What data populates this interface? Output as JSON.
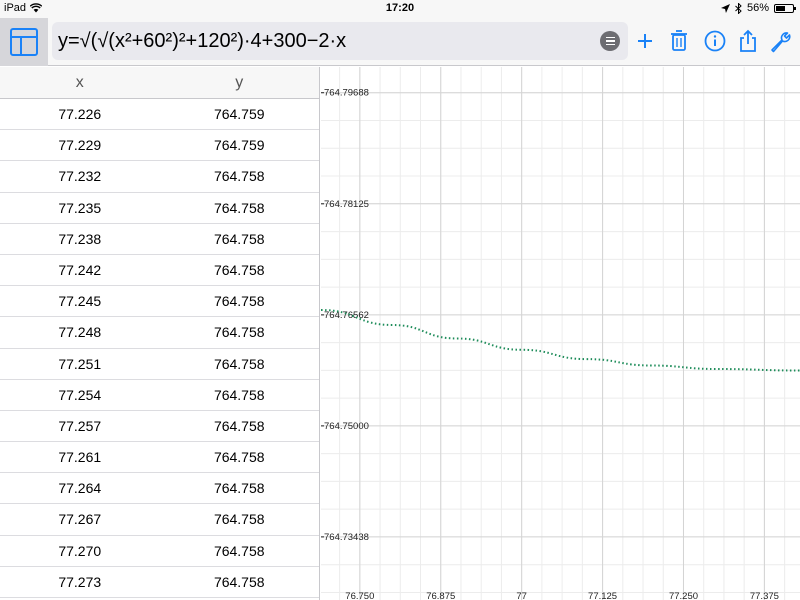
{
  "status_bar": {
    "device": "iPad",
    "time": "17:20",
    "battery": "56%",
    "battery_level": 0.56
  },
  "toolbar": {
    "formula": "y=√(√(x²+60²)²+120²)·4+300−2·x",
    "icons": [
      "table-toggle-icon",
      "menu-icon",
      "add-icon",
      "trash-icon",
      "info-icon",
      "share-icon",
      "wrench-icon"
    ]
  },
  "table": {
    "headers": [
      "x",
      "y"
    ],
    "rows": [
      [
        "77.226",
        "764.759"
      ],
      [
        "77.229",
        "764.759"
      ],
      [
        "77.232",
        "764.758"
      ],
      [
        "77.235",
        "764.758"
      ],
      [
        "77.238",
        "764.758"
      ],
      [
        "77.242",
        "764.758"
      ],
      [
        "77.245",
        "764.758"
      ],
      [
        "77.248",
        "764.758"
      ],
      [
        "77.251",
        "764.758"
      ],
      [
        "77.254",
        "764.758"
      ],
      [
        "77.257",
        "764.758"
      ],
      [
        "77.261",
        "764.758"
      ],
      [
        "77.264",
        "764.758"
      ],
      [
        "77.267",
        "764.758"
      ],
      [
        "77.270",
        "764.758"
      ],
      [
        "77.273",
        "764.758"
      ]
    ]
  },
  "chart_data": {
    "type": "line",
    "x_ticks": [
      "76.750",
      "76.875",
      "77",
      "77.125",
      "77.250",
      "77.375"
    ],
    "y_ticks": [
      "764.79688",
      "764.78125",
      "764.76562",
      "764.75000",
      "764.73438"
    ],
    "xlim": [
      76.69,
      77.43
    ],
    "ylim": [
      764.7255,
      764.8005
    ],
    "grid": true,
    "series": [
      {
        "color": "#1e8c5a",
        "style": "dotted",
        "x": [
          76.69,
          76.8,
          76.9,
          77.0,
          77.1,
          77.2,
          77.3,
          77.43
        ],
        "y": [
          764.7663,
          764.7642,
          764.7623,
          764.7607,
          764.7594,
          764.7585,
          764.758,
          764.7578
        ]
      }
    ]
  }
}
